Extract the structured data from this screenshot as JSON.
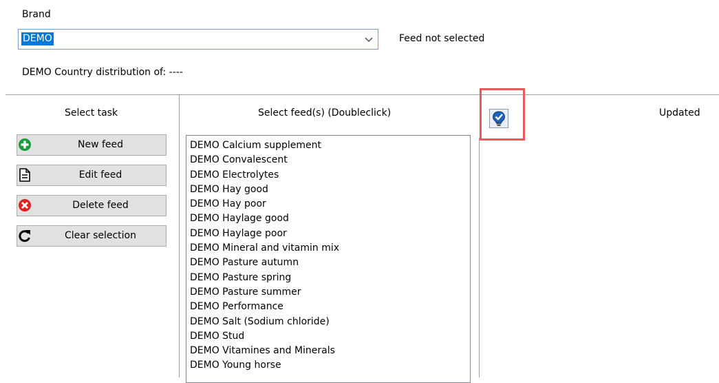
{
  "brand": {
    "label": "Brand",
    "selected_value": "DEMO",
    "icon": "chevron-down-icon"
  },
  "feed_status": "Feed not selected",
  "country_distribution": "DEMO Country distribution of:  ----",
  "columns": {
    "select_task": "Select task",
    "select_feed": "Select feed(s) (Doubleclick)",
    "updated": "Updated"
  },
  "tasks": [
    {
      "label": "New feed",
      "icon": "plus-circle-icon",
      "color": "#1a9c3c"
    },
    {
      "label": "Edit feed",
      "icon": "document-icon",
      "color": "#000000"
    },
    {
      "label": "Delete feed",
      "icon": "delete-circle-icon",
      "color": "#e02020"
    },
    {
      "label": "Clear selection",
      "icon": "refresh-icon",
      "color": "#000000"
    }
  ],
  "feeds": [
    "DEMO Calcium supplement",
    "DEMO Convalescent",
    "DEMO Electrolytes",
    "DEMO Hay good",
    "DEMO Hay poor",
    "DEMO Haylage good",
    "DEMO Haylage poor",
    "DEMO Mineral and vitamin mix",
    "DEMO Pasture autumn",
    "DEMO Pasture spring",
    "DEMO Pasture summer",
    "DEMO Performance",
    "DEMO Salt (Sodium chloride)",
    "DEMO Stud",
    "DEMO Vitamines and Minerals",
    "DEMO Young horse"
  ],
  "bulb_button": {
    "icon": "lightbulb-check-icon"
  },
  "colors": {
    "selection": "#0078d7",
    "highlight": "#e8595b",
    "button_face": "#e1e1e1"
  }
}
